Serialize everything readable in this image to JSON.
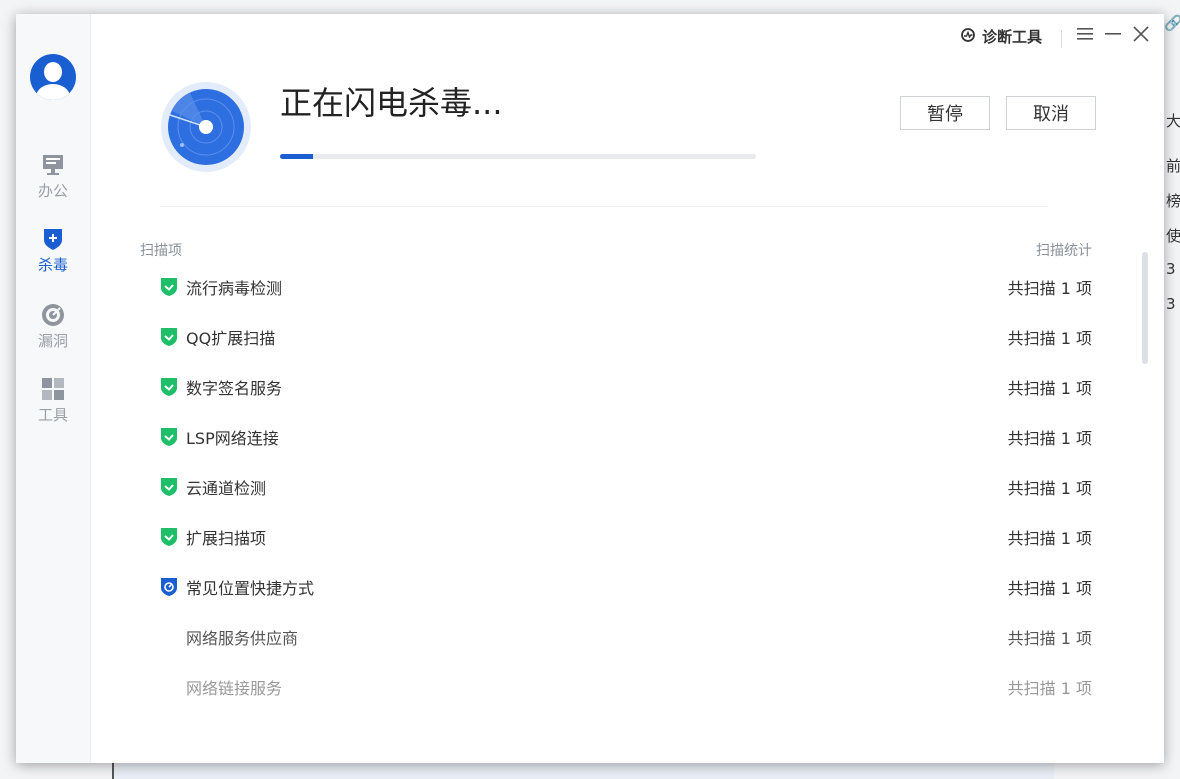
{
  "background_app": {
    "right_glyphs": [
      "大纟",
      "前",
      "榜",
      "使",
      "3",
      "3"
    ]
  },
  "sidebar": {
    "items": [
      {
        "label": "办公",
        "icon": "monitor-icon",
        "active": false
      },
      {
        "label": "杀毒",
        "icon": "shield-plus-icon",
        "active": true
      },
      {
        "label": "漏洞",
        "icon": "target-icon",
        "active": false
      },
      {
        "label": "工具",
        "icon": "grid-icon",
        "active": false
      }
    ]
  },
  "titlebar": {
    "tools_label": "诊断工具"
  },
  "scan": {
    "title": "正在闪电杀毒...",
    "progress": 0.07,
    "pause_label": "暂停",
    "cancel_label": "取消"
  },
  "table": {
    "col_item": "扫描项",
    "col_stat": "扫描统计",
    "rows": [
      {
        "label": "流行病毒检测",
        "stat": "共扫描 1 项",
        "status": "done"
      },
      {
        "label": "QQ扩展扫描",
        "stat": "共扫描 1 项",
        "status": "done"
      },
      {
        "label": "数字签名服务",
        "stat": "共扫描 1 项",
        "status": "done"
      },
      {
        "label": "LSP网络连接",
        "stat": "共扫描 1 项",
        "status": "done"
      },
      {
        "label": "云通道检测",
        "stat": "共扫描 1 项",
        "status": "done"
      },
      {
        "label": "扩展扫描项",
        "stat": "共扫描 1 项",
        "status": "done"
      },
      {
        "label": "常见位置快捷方式",
        "stat": "共扫描 1 项",
        "status": "scanning"
      },
      {
        "label": "网络服务供应商",
        "stat": "共扫描 1 项",
        "status": "pending"
      },
      {
        "label": "网络链接服务",
        "stat": "共扫描 1 项",
        "status": "pending"
      }
    ]
  },
  "colors": {
    "accent": "#1a5fd1",
    "success": "#1fbf6a"
  }
}
